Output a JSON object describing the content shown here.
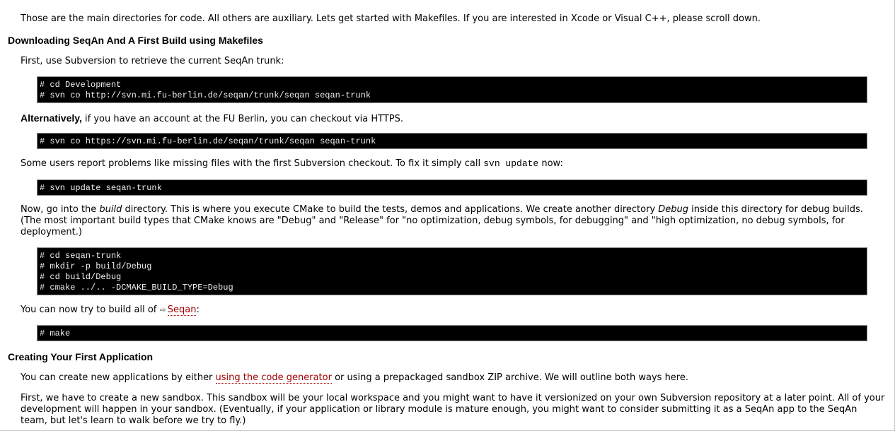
{
  "intro": "Those are the main directories for code. All others are auxiliary. Lets get started with Makefiles. If you are interested in Xcode or Visual C++, please scroll down.",
  "section1": {
    "heading": "Downloading SeqAn And A First Build using Makefiles",
    "p_retrieve": "First, use Subversion to retrieve the current SeqAn trunk:",
    "code_checkout": "# cd Development\n# svn co http://svn.mi.fu-berlin.de/seqan/trunk/seqan seqan-trunk",
    "alt_strong": "Alternatively,",
    "alt_text": " if you have an account at the FU Berlin, you can checkout via HTTPS.",
    "code_https": "# svn co https://svn.mi.fu-berlin.de/seqan/trunk/seqan seqan-trunk",
    "p_problems_before": "Some users report problems like missing files with the first Subversion checkout. To fix it simply call ",
    "p_problems_code": "svn update",
    "p_problems_after": " now:",
    "code_update": "# svn update seqan-trunk",
    "p_build_1": "Now, go into the ",
    "p_build_em1": "build",
    "p_build_2": " directory. This is where you execute CMake to build the tests, demos and applications. We create another directory ",
    "p_build_em2": "Debug",
    "p_build_3": " inside this directory for debug builds. (The most important build types that CMake knows are \"Debug\" and \"Release\" for \"no optimization, debug symbols, for debugging\" and \"high optimization, no debug symbols, for deployment.)",
    "code_cmake": "# cd seqan-trunk\n# mkdir -p build/Debug\n# cd build/Debug\n# cmake ../.. -DCMAKE_BUILD_TYPE=Debug",
    "p_make_before": "You can now try to build all of ",
    "p_make_link": "Seqan",
    "p_make_after": ":",
    "code_make": "# make"
  },
  "section2": {
    "heading": "Creating Your First Application",
    "p_create_before": "You can create new applications by either ",
    "p_create_link": "using the code generator",
    "p_create_after": " or using a prepackaged sandbox ZIP archive. We will outline both ways here.",
    "p_sandbox": "First, we have to create a new sandbox. This sandbox will be your local workspace and you might want to have it versionized on your own Subversion repository at a later point. All of your development will happen in your sandbox. (Eventually, if your application or library module is mature enough, you might want to consider submitting it as a SeqAn app to the SeqAn team, but let's learn to walk before we try to fly.)"
  },
  "colors": {
    "link": "#a00000",
    "code_background": "#000000",
    "code_text": "#f0f0f0"
  },
  "icons": {
    "internal_link": "arrow-right-icon"
  }
}
